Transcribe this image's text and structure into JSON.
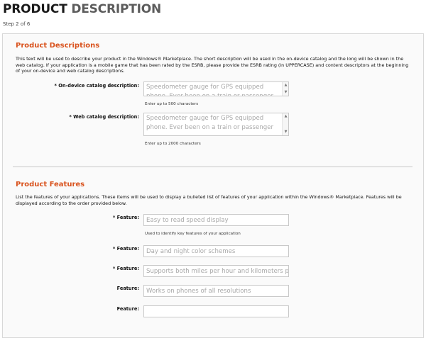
{
  "page": {
    "title_part1": "PRODUCT",
    "title_part2": "DESCRIPTION",
    "step": "Step 2 of 6"
  },
  "descriptions": {
    "title": "Product Descriptions",
    "text": "This text will be used to describe your product in the Windows® Marketplace. The short description will be used in the on-device catalog and the long will be shown in the web catalog. If your application is a mobile game that has been rated by the ESRB, please provide the ESRB rating (in UPPERCASE) and content descriptors at the beginning of your on-device and web catalog descriptions.",
    "on_device": {
      "label": "* On-device catalog description:",
      "value": "Speedometer gauge for GPS equipped phone. Ever been on a train or passenger",
      "hint": "Enter up to 500 characters"
    },
    "web": {
      "label": "* Web catalog description:",
      "value": "Speedometer gauge for GPS equipped phone. Ever been on a train or passenger",
      "hint": "Enter up to 2000 characters"
    }
  },
  "features": {
    "title": "Product Features",
    "text": "List the features of your applications. These items will be used to display a bulleted list of features of your application within the Windows® Marketplace. Features will be displayed according to the order provided below.",
    "feature_hint": "Used to identify key features of your application",
    "items": [
      {
        "label": "* Feature:",
        "value": "Easy to read speed display"
      },
      {
        "label": "* Feature:",
        "value": "Day and night color schemes"
      },
      {
        "label": "* Feature:",
        "value": "Supports both miles per hour and kilometers per hour"
      },
      {
        "label": "Feature:",
        "value": "Works on phones of all resolutions"
      },
      {
        "label": "Feature:",
        "value": ""
      }
    ]
  },
  "icons": {
    "scroll_up": "triangle-up",
    "scroll_down": "triangle-down"
  },
  "colors": {
    "section_title": "#d9531e",
    "placeholder_text": "#a9a9a9",
    "panel_background": "#fafafa"
  }
}
